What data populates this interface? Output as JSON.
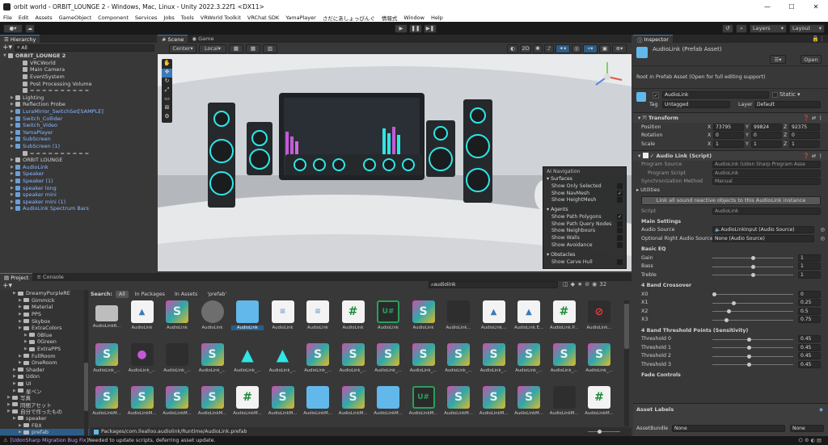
{
  "window": {
    "title": "orbit world - ORBIT_LOUNGE 2 - Windows, Mac, Linux - Unity 2022.3.22f1 <DX11>",
    "minimize": "—",
    "maximize": "☐",
    "close": "✕"
  },
  "menu": [
    "File",
    "Edit",
    "Assets",
    "GameObject",
    "Component",
    "Services",
    "Jobs",
    "Tools",
    "VRWorld Toolkit",
    "VRChat SDK",
    "YamaPlayer",
    "さだにあしょっぴんぐ",
    "情報式",
    "Window",
    "Help"
  ],
  "toolbar": {
    "layers": "Layers",
    "layout": "Layout"
  },
  "hierarchy": {
    "tab": "Hierarchy",
    "search_placeholder": "All",
    "scene": "ORBIT_LOUNGE 2",
    "items": [
      {
        "label": "VRCWorld",
        "indent": 2,
        "blue": false,
        "arrow": false
      },
      {
        "label": "Main Camera",
        "indent": 2,
        "blue": false,
        "arrow": false
      },
      {
        "label": "EventSystem",
        "indent": 2,
        "blue": false,
        "arrow": false
      },
      {
        "label": "Post Processing Volume",
        "indent": 2,
        "blue": false,
        "arrow": false
      },
      {
        "label": "= = = = = = = = = =",
        "indent": 2,
        "blue": false,
        "arrow": false
      },
      {
        "label": "Lighting",
        "indent": 1,
        "blue": false,
        "arrow": true
      },
      {
        "label": "Reflection Probe",
        "indent": 1,
        "blue": false,
        "arrow": true
      },
      {
        "label": "LuraMirror_SwitchSet[SAMPLE]",
        "indent": 1,
        "blue": true,
        "arrow": true
      },
      {
        "label": "Switch_Collider",
        "indent": 1,
        "blue": true,
        "arrow": true
      },
      {
        "label": "Switch_Video",
        "indent": 1,
        "blue": true,
        "arrow": true
      },
      {
        "label": "YamaPlayer",
        "indent": 1,
        "blue": true,
        "arrow": true
      },
      {
        "label": "SubScreen",
        "indent": 1,
        "blue": true,
        "arrow": true
      },
      {
        "label": "SubScreen (1)",
        "indent": 1,
        "blue": true,
        "arrow": true
      },
      {
        "label": "= = = = = = = = = =",
        "indent": 2,
        "blue": false,
        "arrow": false
      },
      {
        "label": "ORBIT LOUNGE",
        "indent": 1,
        "blue": false,
        "arrow": true
      },
      {
        "label": "AudioLink",
        "indent": 1,
        "blue": true,
        "arrow": true
      },
      {
        "label": "Speaker",
        "indent": 1,
        "blue": true,
        "arrow": true
      },
      {
        "label": "Speaker (1)",
        "indent": 1,
        "blue": true,
        "arrow": true
      },
      {
        "label": "speaker long",
        "indent": 1,
        "blue": true,
        "arrow": true
      },
      {
        "label": "speaker mini",
        "indent": 1,
        "blue": true,
        "arrow": true
      },
      {
        "label": "speaker mini (1)",
        "indent": 1,
        "blue": true,
        "arrow": true
      },
      {
        "label": "AudioLink Spectrum Bars",
        "indent": 1,
        "blue": true,
        "arrow": true
      }
    ]
  },
  "scene": {
    "tab_scene": "Scene",
    "tab_game": "Game",
    "pivot": "Center",
    "space": "Local",
    "mode2d": "2D",
    "ainav": {
      "title": "AI Navigation",
      "surfaces": "Surfaces",
      "items1": [
        {
          "label": "Show Only Selected",
          "checked": false
        },
        {
          "label": "Show NavMesh",
          "checked": true
        },
        {
          "label": "Show HeightMesh",
          "checked": false
        }
      ],
      "agents": "Agents",
      "items2": [
        {
          "label": "Show Path Polygons",
          "checked": true
        },
        {
          "label": "Show Path Query Nodes",
          "checked": false
        },
        {
          "label": "Show Neighbours",
          "checked": false
        },
        {
          "label": "Show Walls",
          "checked": false
        },
        {
          "label": "Show Avoidance",
          "checked": false
        }
      ],
      "obstacles": "Obstacles",
      "items3": [
        {
          "label": "Show Carve Hull",
          "checked": false
        }
      ]
    }
  },
  "project": {
    "tab_project": "Project",
    "tab_console": "Console",
    "search": "audiolink",
    "count": "32",
    "search_label": "Search:",
    "filters": [
      "All",
      "In Packages",
      "In Assets",
      "'prefab'"
    ],
    "tree": [
      {
        "label": "DreamyPurpleRE",
        "indent": 2
      },
      {
        "label": "Gimmick",
        "indent": 3
      },
      {
        "label": "Material",
        "indent": 3
      },
      {
        "label": "PPS",
        "indent": 3
      },
      {
        "label": "Skybox",
        "indent": 3
      },
      {
        "label": "ExtraColors",
        "indent": 3
      },
      {
        "label": "0Blue",
        "indent": 4
      },
      {
        "label": "0Green",
        "indent": 4
      },
      {
        "label": "ExtraPPS",
        "indent": 4
      },
      {
        "label": "FullRoom",
        "indent": 3
      },
      {
        "label": "OneRoom",
        "indent": 3
      },
      {
        "label": "Shader",
        "indent": 2
      },
      {
        "label": "Udon",
        "indent": 2
      },
      {
        "label": "UI",
        "indent": 2
      },
      {
        "label": "星ペン",
        "indent": 2
      },
      {
        "label": "写真",
        "indent": 1
      },
      {
        "label": "同梱アセット",
        "indent": 1
      },
      {
        "label": "自分で作ったもの",
        "indent": 1
      },
      {
        "label": "speaker",
        "indent": 2
      },
      {
        "label": "FBX",
        "indent": 3
      },
      {
        "label": "prefab",
        "indent": 3
      }
    ],
    "assets": [
      {
        "label": "AudioLinkR...",
        "type": "fol"
      },
      {
        "label": "AudioLink",
        "type": "doc-blue"
      },
      {
        "label": "AudioLink",
        "type": "s"
      },
      {
        "label": "AudioLink",
        "type": "grey"
      },
      {
        "label": "AudioLink",
        "type": "box",
        "selected": true
      },
      {
        "label": "AudioLink",
        "type": "doc"
      },
      {
        "label": "AudioLink",
        "type": "doc"
      },
      {
        "label": "AudioLink",
        "type": "h"
      },
      {
        "label": "AudioLink",
        "type": "unity"
      },
      {
        "label": "AudioLink",
        "type": "s"
      },
      {
        "label": "AudioLink...",
        "type": "dark"
      },
      {
        "label": "AudioLink...",
        "type": "doc-blue"
      },
      {
        "label": "AudioLink.E...",
        "type": "doc-blue"
      },
      {
        "label": "AudioLink.P...",
        "type": "h"
      },
      {
        "label": "AudioLink...",
        "type": "red"
      },
      {
        "label": "AudioLink_...",
        "type": "s"
      },
      {
        "label": "AudioLink_...",
        "type": "dark2"
      },
      {
        "label": "AudioLink_...",
        "type": "dark"
      },
      {
        "label": "AudioLink_...",
        "type": "s"
      },
      {
        "label": "AudioLink_...",
        "type": "tri"
      },
      {
        "label": "AudioLink_...",
        "type": "tri"
      },
      {
        "label": "AudioLink_...",
        "type": "s"
      },
      {
        "label": "AudioLink_...",
        "type": "s"
      },
      {
        "label": "AudioLink_...",
        "type": "s"
      },
      {
        "label": "AudioLink_...",
        "type": "s"
      },
      {
        "label": "AudioLink_...",
        "type": "s"
      },
      {
        "label": "AudioLink_...",
        "type": "s"
      },
      {
        "label": "AudioLink_...",
        "type": "s"
      },
      {
        "label": "AudioLink_...",
        "type": "s"
      },
      {
        "label": "AudioLink_...",
        "type": "s"
      },
      {
        "label": "AudioLinkM...",
        "type": "s"
      },
      {
        "label": "AudioLinkM...",
        "type": "s"
      },
      {
        "label": "AudioLinkM...",
        "type": "s"
      },
      {
        "label": "AudioLinkM...",
        "type": "s"
      },
      {
        "label": "AudioLinkM...",
        "type": "h"
      },
      {
        "label": "AudioLinkM...",
        "type": "s"
      },
      {
        "label": "AudioLinkM...",
        "type": "box"
      },
      {
        "label": "AudioLinkM...",
        "type": "s"
      },
      {
        "label": "AudioLinkM...",
        "type": "box"
      },
      {
        "label": "AudioLinkM...",
        "type": "unity"
      },
      {
        "label": "AudioLinkM...",
        "type": "s"
      },
      {
        "label": "AudioLinkM...",
        "type": "s"
      },
      {
        "label": "AudioLinkM...",
        "type": "s"
      },
      {
        "label": "AudioLinkM...",
        "type": "dark"
      },
      {
        "label": "AudioLinkM...",
        "type": "h"
      }
    ],
    "path": "Packages/com.llealloo.audiolink/Runtime/AudioLink.prefab"
  },
  "inspector": {
    "tab": "Inspector",
    "title": "AudioLink (Prefab Asset)",
    "open": "Open",
    "root_note": "Root in Prefab Asset (Open for full editing support)",
    "name": "AudioLink",
    "static": "Static",
    "tag_label": "Tag",
    "tag": "Untagged",
    "layer_label": "Layer",
    "layer": "Default",
    "transform": {
      "title": "Transform",
      "position": {
        "label": "Position",
        "x": "73795",
        "y": "99824",
        "z": "92375"
      },
      "rotation": {
        "label": "Rotation",
        "x": "0",
        "y": "0",
        "z": "0"
      },
      "scale": {
        "label": "Scale",
        "x": "1",
        "y": "1",
        "z": "1"
      }
    },
    "script": {
      "title": "Audio Link (Script)",
      "program_source_label": "Program Source",
      "program_source": "AudioLink (Udon Sharp Program Asse",
      "program_script_label": "Program Script",
      "program_script": "AudioLink",
      "sync_label": "Synchronization Method",
      "sync": "Manual",
      "utilities": "Utilities",
      "link_button": "Link all sound reactive objects to this AudioLink instance",
      "script_label": "Script",
      "script_val": "AudioLink",
      "main_settings": "Main Settings",
      "audio_source_label": "Audio Source",
      "audio_source": "AudioLinkInput (Audio Source)",
      "right_source_label": "Optional Right Audio Source",
      "right_source": "None (Audio Source)",
      "basic_eq": "Basic EQ",
      "eq": [
        {
          "label": "Gain",
          "value": "1",
          "pos": 0.5
        },
        {
          "label": "Bass",
          "value": "1",
          "pos": 0.5
        },
        {
          "label": "Treble",
          "value": "1",
          "pos": 0.5
        }
      ],
      "crossover": "4 Band Crossover",
      "cross": [
        {
          "label": "X0",
          "value": "0",
          "pos": 0.0
        },
        {
          "label": "X1",
          "value": "0.25",
          "pos": 0.25
        },
        {
          "label": "X2",
          "value": "0.5",
          "pos": 0.19
        },
        {
          "label": "X3",
          "value": "0.75",
          "pos": 0.16
        }
      ],
      "threshold": "4 Band Threshold Points (Sensitivity)",
      "thr": [
        {
          "label": "Threshold 0",
          "value": "0.45",
          "pos": 0.45
        },
        {
          "label": "Threshold 1",
          "value": "0.45",
          "pos": 0.45
        },
        {
          "label": "Threshold 2",
          "value": "0.45",
          "pos": 0.45
        },
        {
          "label": "Threshold 3",
          "value": "0.45",
          "pos": 0.45
        }
      ],
      "fade": "Fade Controls"
    },
    "asset_labels": "Asset Labels",
    "asset_bundle_label": "AssetBundle",
    "asset_bundle": "None",
    "asset_variant": "None"
  },
  "status": {
    "tag": "[UdonSharp Migration Bug Fix]",
    "message": " Needed to update scripts, deferring asset update."
  },
  "colors": {
    "accent": "#3a79bb",
    "selection": "#2c5d87",
    "audiolink_cyan": "#2ee6e6"
  }
}
